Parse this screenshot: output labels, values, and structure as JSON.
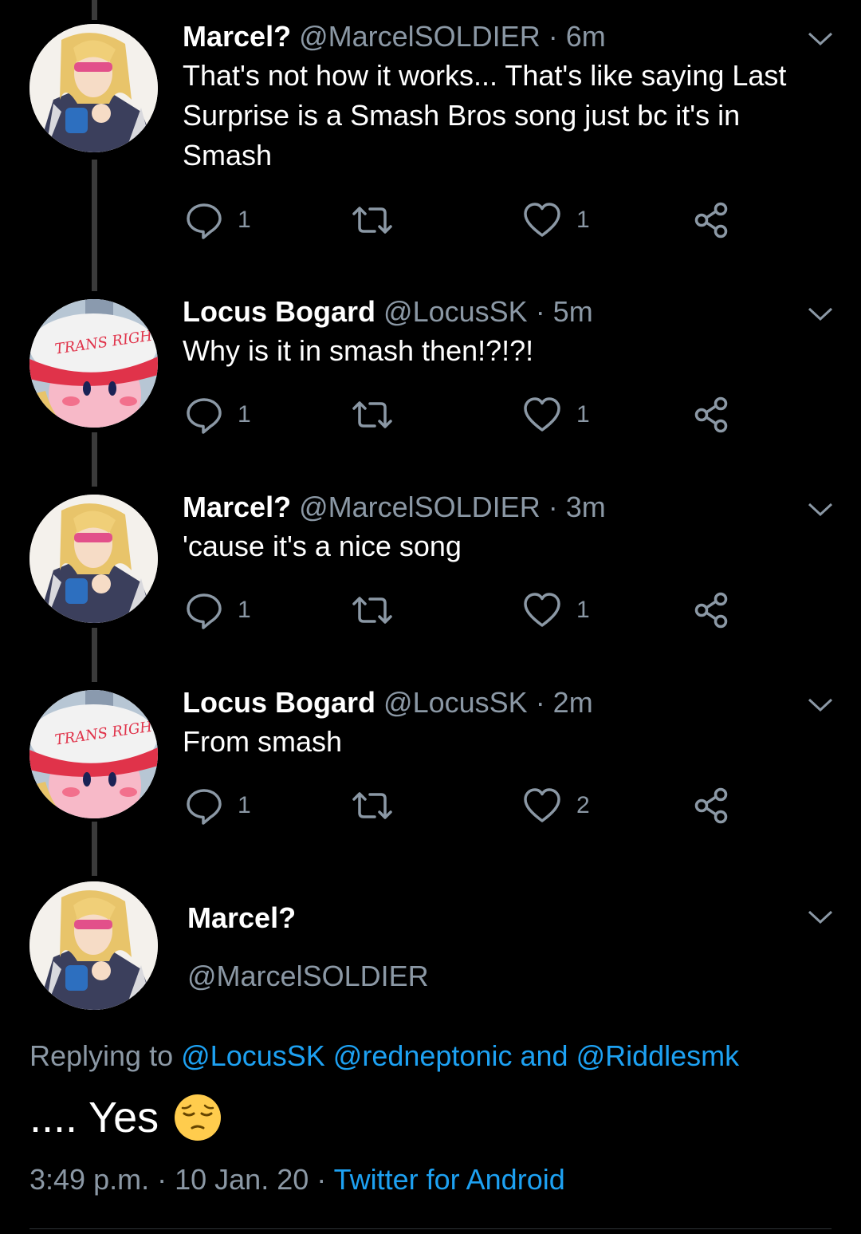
{
  "tweets": [
    {
      "name": "Marcel?",
      "handle": "@MarcelSOLDIER",
      "time": "· 6m",
      "text": "That's not how it works... That's like saying Last Surprise is a Smash Bros song just bc it's in Smash",
      "replies": "1",
      "likes": "1",
      "avatar": "marcel"
    },
    {
      "name": "Locus Bogard",
      "handle": "@LocusSK",
      "time": "· 5m",
      "text": "Why is it in smash then!?!?!",
      "replies": "1",
      "likes": "1",
      "avatar": "locus"
    },
    {
      "name": "Marcel?",
      "handle": "@MarcelSOLDIER",
      "time": "· 3m",
      "text": "'cause it's a nice song",
      "replies": "1",
      "likes": "1",
      "avatar": "marcel"
    },
    {
      "name": "Locus Bogard",
      "handle": "@LocusSK",
      "time": "· 2m",
      "text": "From smash",
      "replies": "1",
      "likes": "2",
      "avatar": "locus"
    }
  ],
  "main": {
    "name": "Marcel?",
    "handle": "@MarcelSOLDIER",
    "replying_prefix": "Replying to",
    "reply_1": "@LocusSK",
    "reply_2": "@redneptonic",
    "reply_and": "and",
    "reply_3": "@Riddlesmk",
    "text": ".... Yes",
    "emoji": "pensive-face-emoji",
    "time": "3:49 p.m.",
    "date": "10 Jan. 20",
    "source": "Twitter for Android"
  },
  "hat_text": "TRANS RIGHTS",
  "colors": {
    "background": "#000000",
    "muted": "#8b98a5",
    "link": "#1da1f2",
    "thread": "#3a3a3a"
  },
  "icons": [
    "reply-icon",
    "retweet-icon",
    "like-icon",
    "share-icon",
    "chevron-down-icon"
  ]
}
